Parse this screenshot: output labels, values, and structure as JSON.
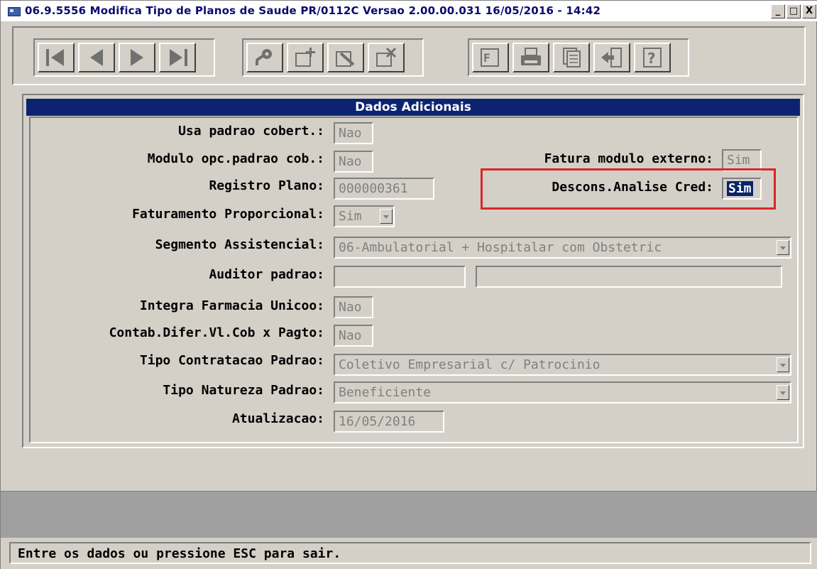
{
  "window": {
    "title": "06.9.5556  Modifica Tipo de Planos de Saude PR/0112C Versao 2.00.00.031 16/05/2016 - 14:42",
    "controls": [
      "_",
      "□",
      "X"
    ]
  },
  "toolbar": {
    "nav_buttons": [
      "first-record-icon",
      "previous-record-icon",
      "next-record-icon",
      "last-record-icon"
    ],
    "edit_buttons": [
      "search-key-icon",
      "add-record-icon",
      "edit-record-icon",
      "delete-record-icon"
    ],
    "util_buttons": [
      "filter-icon",
      "print-icon",
      "copy-icon",
      "exit-icon",
      "help-icon"
    ]
  },
  "panel": {
    "title": "Dados Adicionais",
    "fields": {
      "usa_padrao_cobert": {
        "label": "Usa padrao cobert.:",
        "value": "Nao"
      },
      "modulo_opc_padrao_cob": {
        "label": "Modulo opc.padrao cob.:",
        "value": "Nao"
      },
      "fatura_modulo_externo": {
        "label": "Fatura modulo externo:",
        "value": "Sim"
      },
      "registro_plano": {
        "label": "Registro Plano:",
        "value": "000000361"
      },
      "descons_analise_cred": {
        "label": "Descons.Analise Cred:",
        "value": "Sim"
      },
      "faturamento_proporcional": {
        "label": "Faturamento Proporcional:",
        "value": "Sim"
      },
      "segmento_assistencial": {
        "label": "Segmento Assistencial:",
        "value": "06-Ambulatorial + Hospitalar com Obstetric"
      },
      "auditor_padrao": {
        "label": "Auditor padrao:",
        "value": "",
        "value2": ""
      },
      "integra_farmacia_unicoo": {
        "label": "Integra Farmacia Unicoo:",
        "value": "Nao"
      },
      "contab_difer": {
        "label": "Contab.Difer.Vl.Cob x Pagto:",
        "value": "Nao"
      },
      "tipo_contratacao_padrao": {
        "label": "Tipo Contratacao Padrao:",
        "value": "Coletivo Empresarial c/ Patrocinio"
      },
      "tipo_natureza_padrao": {
        "label": "Tipo Natureza Padrao:",
        "value": "Beneficiente"
      },
      "atualizacao": {
        "label": "Atualizacao:",
        "value": "16/05/2016"
      }
    }
  },
  "status": {
    "message": "Entre os dados ou pressione ESC para sair."
  },
  "colors": {
    "window_bg": "#d4d0c8",
    "panel_title_bg": "#0c2470",
    "highlight_border": "#d9262a",
    "selection_bg": "#0a246a"
  }
}
